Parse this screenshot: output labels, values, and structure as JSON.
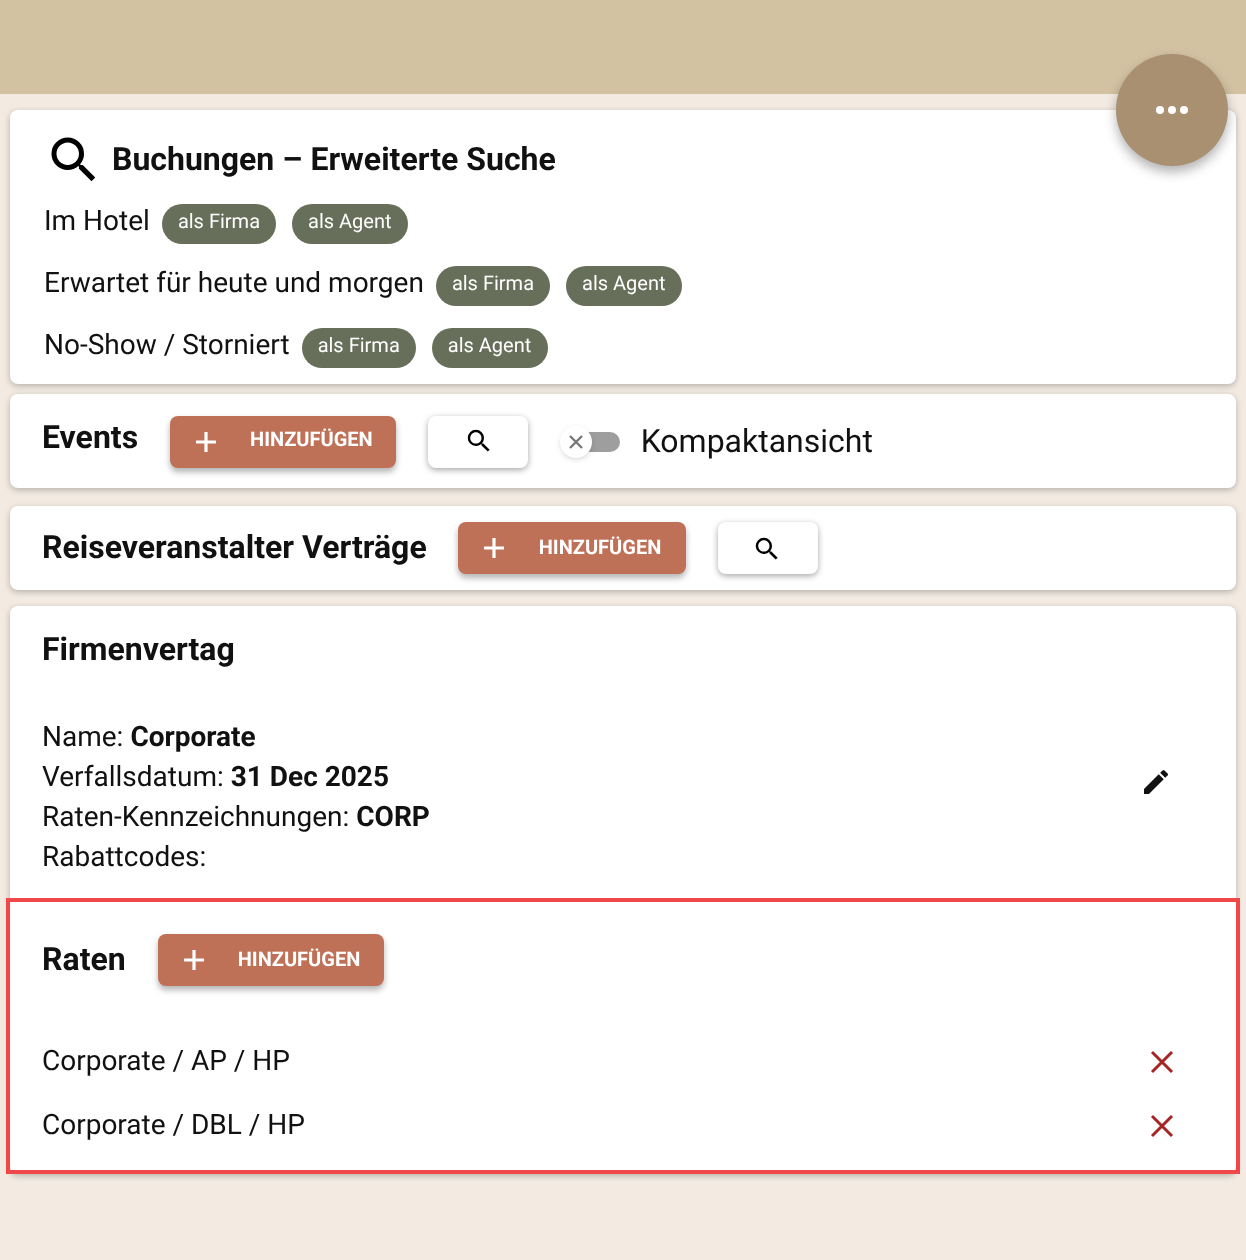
{
  "search_card": {
    "title": "Buchungen – Erweiterte Suche",
    "rows": [
      {
        "label": "Im Hotel",
        "chips": [
          "als Firma",
          "als Agent"
        ]
      },
      {
        "label": "Erwartet für heute und morgen",
        "chips": [
          "als Firma",
          "als Agent"
        ]
      },
      {
        "label": "No-Show / Storniert",
        "chips": [
          "als Firma",
          "als Agent"
        ]
      }
    ]
  },
  "events": {
    "title": "Events",
    "add_button": "HINZUFÜGEN",
    "toggle": {
      "label": "Kompaktansicht",
      "on": false
    }
  },
  "contracts": {
    "title": "Reiseveranstalter Verträge",
    "add_button": "HINZUFÜGEN"
  },
  "company_contract": {
    "title": "Firmenvertag",
    "fields": [
      {
        "label": "Name:",
        "value": "Corporate"
      },
      {
        "label": "Verfallsdatum:",
        "value": "31 Dec 2025"
      },
      {
        "label": "Raten-Kennzeichnungen:",
        "value": "CORP"
      },
      {
        "label": "Rabattcodes:"
      }
    ],
    "rates": {
      "title": "Raten",
      "add_button": "HINZUFÜGEN",
      "highlighted": true,
      "items": [
        "Corporate / AP / HP",
        "Corporate / DBL / HP"
      ]
    }
  }
}
